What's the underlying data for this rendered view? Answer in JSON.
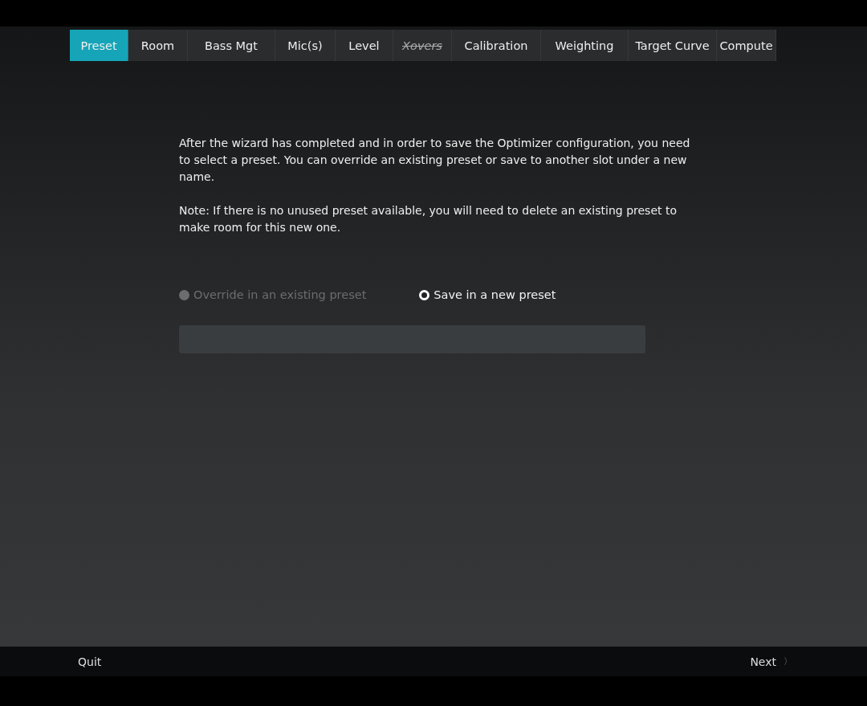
{
  "tabs": [
    {
      "label": "Preset",
      "selected": true,
      "disabled": false
    },
    {
      "label": "Room",
      "selected": false,
      "disabled": false
    },
    {
      "label": "Bass Mgt",
      "selected": false,
      "disabled": false
    },
    {
      "label": "Mic(s)",
      "selected": false,
      "disabled": false
    },
    {
      "label": "Level",
      "selected": false,
      "disabled": false
    },
    {
      "label": "Xovers",
      "selected": false,
      "disabled": true
    },
    {
      "label": "Calibration",
      "selected": false,
      "disabled": false
    },
    {
      "label": "Weighting",
      "selected": false,
      "disabled": false
    },
    {
      "label": "Target Curve",
      "selected": false,
      "disabled": false
    },
    {
      "label": "Compute",
      "selected": false,
      "disabled": false
    }
  ],
  "paragraphs": [
    "After the wizard has completed and in order to save the Optimizer configuration, you need to select a preset. You can override an existing preset or save to another slot under a new name.",
    "Note: If there is no unused preset available, you will need to delete an existing preset to make room for this new one."
  ],
  "options": [
    {
      "label": "Override in an existing preset",
      "selected": false,
      "disabled": true
    },
    {
      "label": "Save in a new preset",
      "selected": true,
      "disabled": false
    }
  ],
  "footer": {
    "quit": "Quit",
    "next": "Next",
    "next_arrow": "〉"
  }
}
